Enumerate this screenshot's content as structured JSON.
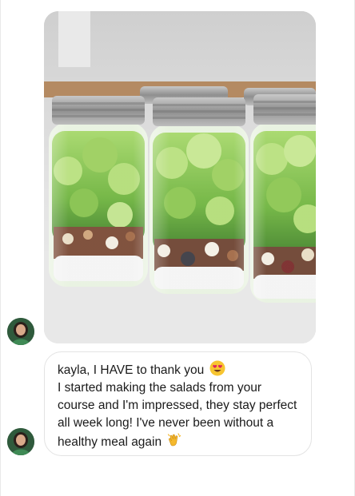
{
  "messages": [
    {
      "type": "image",
      "alt": "",
      "icon": "photo-of-salad-jars"
    },
    {
      "type": "text",
      "line1": "kayla, I HAVE to thank you",
      "line1_emoji": "heart-eyes-emoji",
      "body": "I started making the salads from your course and I'm impressed, they stay perfect all week long! I've never been without a healthy meal again",
      "body_emoji": "clapping-hands-emoji"
    }
  ],
  "sender": {
    "avatar_icon": "avatar"
  },
  "colors": {
    "bubble_border": "#e3e3e3",
    "text": "#1a1a1a",
    "lettuce": "#7fbf4d",
    "jar_lid": "#9a9a9a"
  }
}
